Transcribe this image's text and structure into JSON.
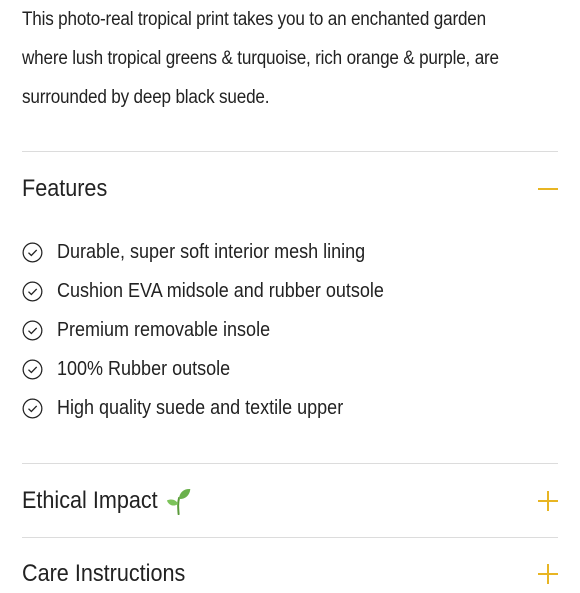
{
  "description": {
    "lines": [
      "This photo-real tropical print takes you to an enchanted garden",
      "where lush tropical greens & turquoise, rich orange & purple, are",
      "surrounded by deep black suede."
    ]
  },
  "accordion": {
    "features": {
      "title": "Features",
      "expanded": true,
      "toggle_icon": "minus-icon",
      "items": [
        "Durable, super soft interior mesh lining",
        "Cushion EVA midsole and rubber outsole",
        "Premium removable insole",
        "100% Rubber outsole",
        "High quality suede and textile upper"
      ],
      "item_icon": "check-circle-icon"
    },
    "ethical_impact": {
      "title": "Ethical Impact",
      "title_icon": "sprout-icon",
      "expanded": false,
      "toggle_icon": "plus-icon"
    },
    "care_instructions": {
      "title": "Care Instructions",
      "expanded": false,
      "toggle_icon": "plus-icon"
    }
  },
  "colors": {
    "accent": "#e8b523",
    "text": "#222222",
    "divider": "#dcdcdc",
    "sprout": "#6ab04c"
  }
}
